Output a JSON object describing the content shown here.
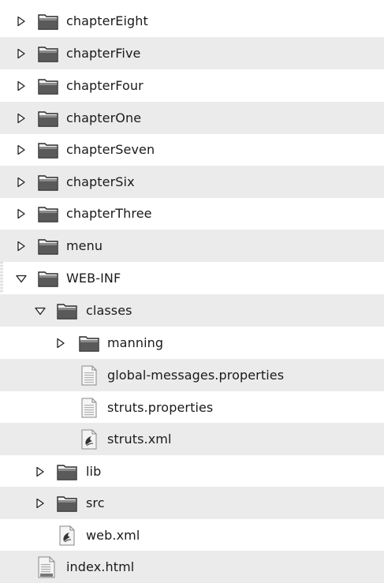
{
  "tree": {
    "rows": [
      {
        "label": "chapterEight",
        "icon": "folder-icon",
        "toggle": "collapsed"
      },
      {
        "label": "chapterFive",
        "icon": "folder-icon",
        "toggle": "collapsed"
      },
      {
        "label": "chapterFour",
        "icon": "folder-icon",
        "toggle": "collapsed"
      },
      {
        "label": "chapterOne",
        "icon": "folder-icon",
        "toggle": "collapsed"
      },
      {
        "label": "chapterSeven",
        "icon": "folder-icon",
        "toggle": "collapsed"
      },
      {
        "label": "chapterSix",
        "icon": "folder-icon",
        "toggle": "collapsed"
      },
      {
        "label": "chapterThree",
        "icon": "folder-icon",
        "toggle": "collapsed"
      },
      {
        "label": "menu",
        "icon": "folder-icon",
        "toggle": "collapsed"
      },
      {
        "label": "WEB-INF",
        "icon": "folder-icon",
        "toggle": "expanded"
      },
      {
        "label": "classes",
        "icon": "folder-icon",
        "toggle": "expanded"
      },
      {
        "label": "manning",
        "icon": "folder-icon",
        "toggle": "collapsed"
      },
      {
        "label": "global-messages.properties",
        "icon": "properties-file-icon",
        "toggle": "none"
      },
      {
        "label": "struts.properties",
        "icon": "properties-file-icon",
        "toggle": "none"
      },
      {
        "label": "struts.xml",
        "icon": "xml-file-icon",
        "toggle": "none"
      },
      {
        "label": "lib",
        "icon": "folder-icon",
        "toggle": "collapsed"
      },
      {
        "label": "src",
        "icon": "folder-icon",
        "toggle": "collapsed"
      },
      {
        "label": "web.xml",
        "icon": "xml-file-icon",
        "toggle": "none"
      },
      {
        "label": "index.html",
        "icon": "html-file-icon",
        "toggle": "none"
      }
    ]
  },
  "colors": {
    "row_alt_background": "#ebebeb",
    "row_background": "#ffffff",
    "text": "#1a1a1a",
    "folder_fill": "#5a5a5a"
  }
}
